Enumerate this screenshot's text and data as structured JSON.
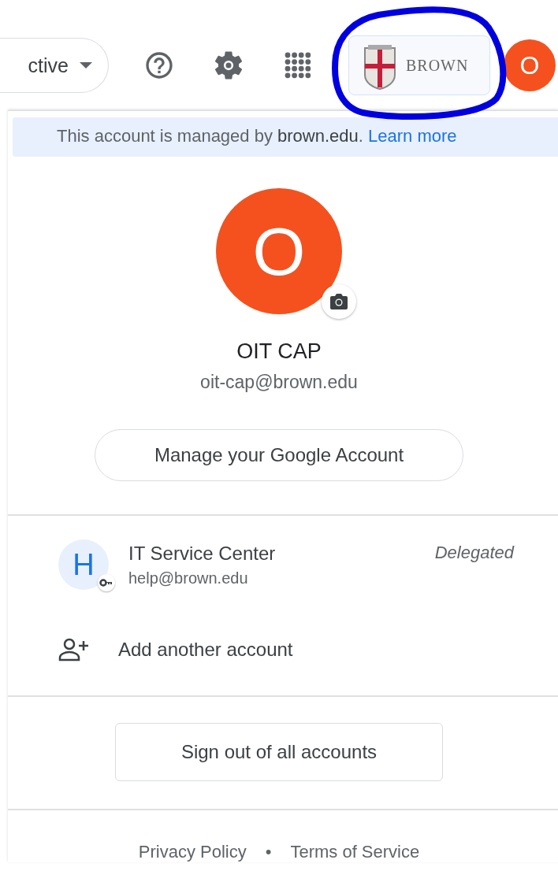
{
  "toolbar": {
    "status_filter": "ctive",
    "brand": "BROWN",
    "avatar_letter": "O"
  },
  "banner": {
    "text": "This account is managed by **brown.edu**.",
    "link": "Learn more"
  },
  "profile": {
    "avatar_letter": "O",
    "name": "OIT CAP",
    "email": "oit-cap@brown.edu",
    "manage_button": "Manage your Google Account"
  },
  "accounts": [
    {
      "avatar_letter": "H",
      "name": "IT Service Center",
      "email": "help@brown.edu",
      "role": "Delegated"
    }
  ],
  "add_account": "Add another account",
  "sign_out": "Sign out of all accounts",
  "footer": {
    "links": [
      "Privacy Policy",
      "Terms of Service"
    ],
    "separator": "•"
  }
}
